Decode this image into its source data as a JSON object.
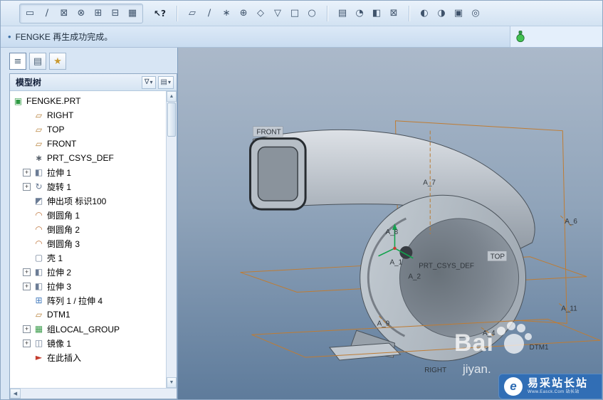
{
  "toolbar": {
    "g1": [
      "▭",
      "∕",
      "⊠",
      "⊗",
      "⊞",
      "⊟",
      "▦"
    ],
    "help": "↖?",
    "g2": [
      "▱",
      "∕",
      "∗",
      "⊕",
      "◇",
      "▽",
      "□",
      "○"
    ],
    "g3": [
      "▤",
      "◔",
      "◧",
      "⊠"
    ],
    "g4": [
      "◐",
      "◑",
      "▣",
      "◎"
    ]
  },
  "statusbar": {
    "bullet": "•",
    "message": "FENGKE 再生成功完成。"
  },
  "panel": {
    "tabs": [
      {
        "glyph": "≡"
      },
      {
        "glyph": "▤"
      },
      {
        "glyph": "★"
      }
    ],
    "header": {
      "title": "模型树",
      "filter_glyph": "∇",
      "settings_glyph": "▤",
      "caret": "▾"
    },
    "scroll": {
      "up": "▲",
      "down": "▼",
      "left": "◀"
    }
  },
  "tree": {
    "expand_glyph": "+",
    "items": [
      {
        "label": "FENGKE.PRT",
        "icon": "part",
        "glyph": "▣"
      },
      {
        "label": "RIGHT",
        "icon": "datum-plane",
        "glyph": "▱"
      },
      {
        "label": "TOP",
        "icon": "datum-plane",
        "glyph": "▱"
      },
      {
        "label": "FRONT",
        "icon": "datum-plane",
        "glyph": "▱"
      },
      {
        "label": "PRT_CSYS_DEF",
        "icon": "csys",
        "glyph": "∗"
      },
      {
        "label": "拉伸 1",
        "icon": "extrude",
        "glyph": "◧"
      },
      {
        "label": "旋转 1",
        "icon": "revolve",
        "glyph": "↻"
      },
      {
        "label": "伸出项 标识100",
        "icon": "protrusion",
        "glyph": "◩"
      },
      {
        "label": "倒圆角 1",
        "icon": "round",
        "glyph": "◠"
      },
      {
        "label": "倒圆角 2",
        "icon": "round",
        "glyph": "◠"
      },
      {
        "label": "倒圆角 3",
        "icon": "round",
        "glyph": "◠"
      },
      {
        "label": "壳 1",
        "icon": "shell",
        "glyph": "▢"
      },
      {
        "label": "拉伸 2",
        "icon": "extrude",
        "glyph": "◧"
      },
      {
        "label": "拉伸 3",
        "icon": "extrude",
        "glyph": "◧"
      },
      {
        "label": "阵列 1 / 拉伸 4",
        "icon": "pattern",
        "glyph": "⊞"
      },
      {
        "label": "DTM1",
        "icon": "datum-plane",
        "glyph": "▱"
      },
      {
        "label": "组LOCAL_GROUP",
        "icon": "group",
        "glyph": "▦"
      },
      {
        "label": "镜像 1",
        "icon": "mirror",
        "glyph": "◫"
      },
      {
        "label": "在此插入",
        "icon": "insert-here",
        "glyph": "►"
      }
    ]
  },
  "viewport": {
    "labels": {
      "front": "FRONT",
      "top": "TOP",
      "right": "RIGHT",
      "csys": "PRT_CSYS_DEF",
      "dtm1": "DTM1",
      "a1": "A_1",
      "a2": "A_2",
      "a4": "A_4",
      "a6": "A_6",
      "a7": "A_7",
      "a8": "A_8",
      "a9": "A_9",
      "a11": "A_11"
    }
  },
  "watermark": {
    "brand": "Bai",
    "script": "jiyan.",
    "badge_logo": "e",
    "badge_title": "易采站长站",
    "badge_sub": "Www.Easck.Com 站长站"
  }
}
